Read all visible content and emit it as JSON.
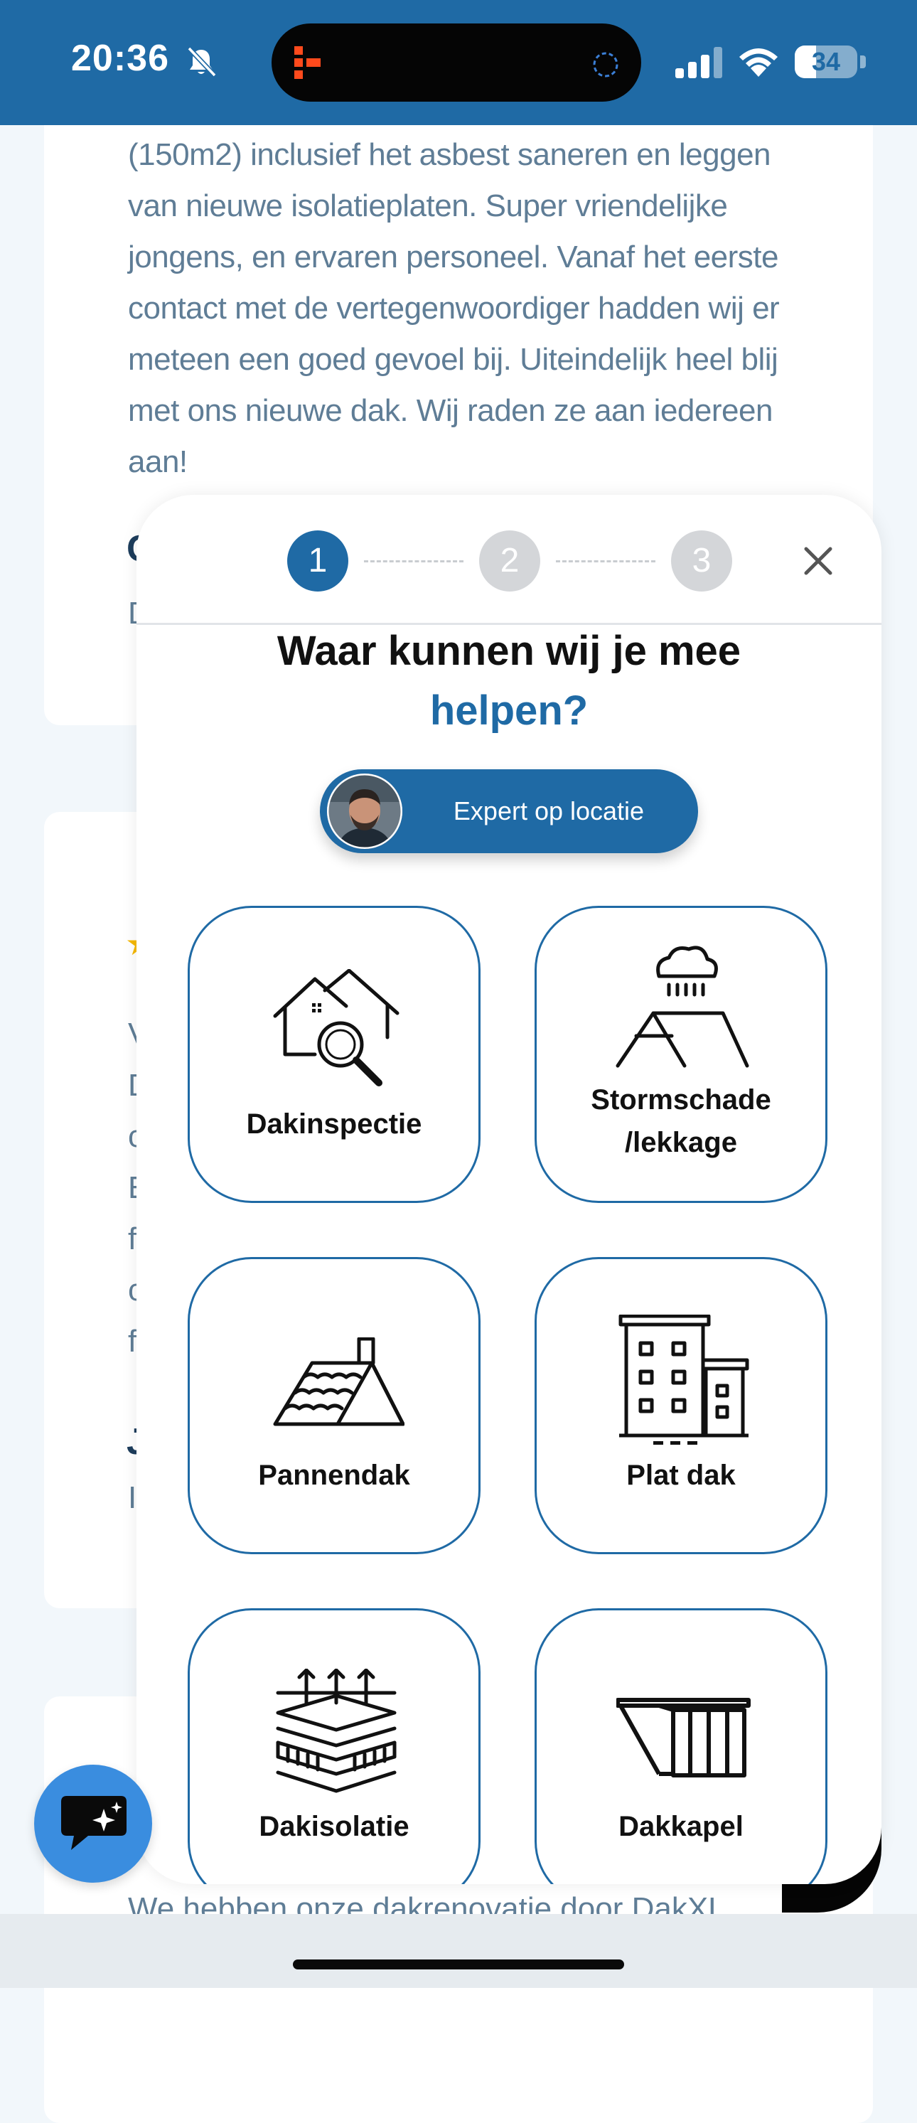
{
  "status_bar": {
    "time": "20:36",
    "battery": "34",
    "battery_level": 0.34,
    "icons": [
      "bell-slash-icon",
      "app-activity-icon",
      "loading-ring-icon",
      "signal-icon",
      "wifi-icon",
      "battery-icon"
    ]
  },
  "background": {
    "review_text": "(150m2) inclusief het asbest saneren en leggen van nieuwe isolatieplaten. Super vriendelijke jongens, en ervaren personeel. Vanaf het eerste contact met de vertegenwoordiger hadden wij er meteen een goed gevoel bij. Uiteindelijk heel blij met ons nieuwe dak. Wij raden ze aan iedereen aan!",
    "name_fragment_1": "C",
    "text_fragment_1": "D",
    "review2_fragments": [
      "V",
      "D",
      "c",
      "E",
      "f",
      "c",
      "f"
    ],
    "name_fragment_2": "J",
    "text_fragment_2": "I",
    "bottom_text": "We hebben onze dakrenovatie door DakXL"
  },
  "modal": {
    "steps": [
      "1",
      "2",
      "3"
    ],
    "active_step": 1,
    "title_line_1": "Waar kunnen wij je mee",
    "title_line_2": "helpen?",
    "expert_button": "Expert op locatie",
    "tiles": [
      {
        "label": "Dakinspectie",
        "icon": "roof-inspection-icon"
      },
      {
        "label_line_1": "Stormschade",
        "label_line_2": "/lekkage",
        "icon": "storm-damage-icon"
      },
      {
        "label": "Pannendak",
        "icon": "tiled-roof-icon"
      },
      {
        "label": "Plat dak",
        "icon": "flat-roof-building-icon"
      },
      {
        "label": "Dakisolatie",
        "icon": "roof-insulation-icon"
      },
      {
        "label": "Dakkapel",
        "icon": "dormer-icon"
      }
    ]
  },
  "colors": {
    "brand_blue": "#1f6aa5",
    "chat_blue": "#3a8ddf",
    "inactive_step": "#d4d6d9",
    "body_text": "#5f7d96"
  }
}
